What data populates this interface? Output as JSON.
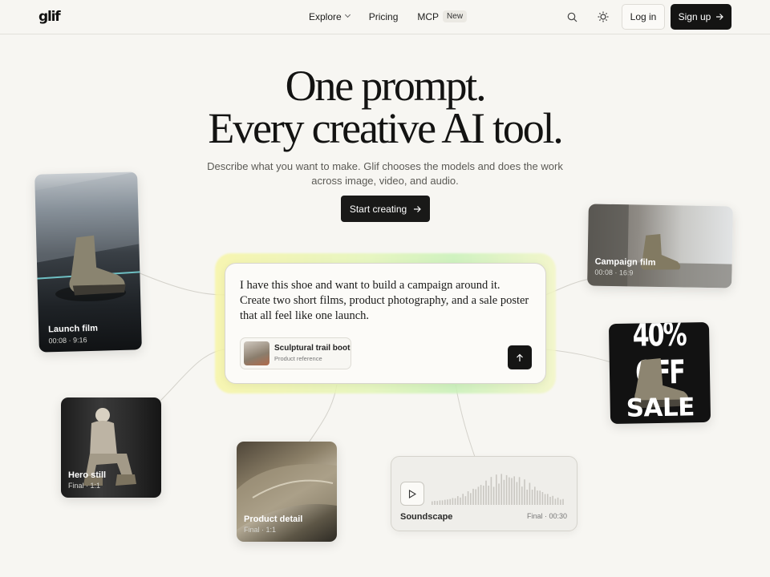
{
  "nav": {
    "logo": "glif",
    "links": [
      {
        "label": "Explore"
      },
      {
        "label": "Pricing"
      },
      {
        "label": "MCP",
        "badge": "New"
      }
    ],
    "login_label": "Log in",
    "signup_label": "Sign up"
  },
  "hero": {
    "title_line1": "One prompt.",
    "title_line2": "Every creative AI tool.",
    "subtitle": "Describe what you want to make. Glif chooses the models and does the work across image, video, and audio.",
    "cta_label": "Start creating"
  },
  "prompt": {
    "text": "I have this shoe and want to build a campaign around it. Create two short films, product photography, and a sale poster that all feel like one launch.",
    "attachment_title": "Sculptural trail boot",
    "attachment_subtitle": "Product reference"
  },
  "cards": {
    "launch": {
      "label": "Launch film",
      "meta": "00:08 · 9:16"
    },
    "campaign": {
      "label": "Campaign film",
      "meta": "00:08 · 16:9"
    },
    "sale": {
      "line1": "40% OFF",
      "line2": "SALE"
    },
    "hero": {
      "label": "Hero still",
      "meta": "Final · 1:1"
    },
    "detail": {
      "label": "Product detail",
      "meta": "Final · 1:1"
    },
    "sound": {
      "label": "Soundscape",
      "meta": "Final · 00:30"
    }
  },
  "colors": {
    "background": "#f7f6f2",
    "primary_button": "#141413",
    "glow_yellow": "#f7f5a6",
    "glow_green": "#c9f2b8"
  }
}
